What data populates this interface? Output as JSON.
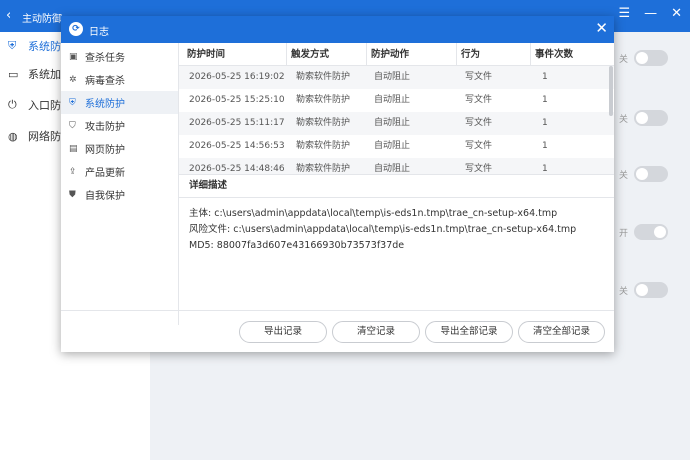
{
  "bg": {
    "title": "主动防御",
    "back_glyph": "‹",
    "win_buttons": [
      "☰",
      "—",
      "✕"
    ],
    "sidebar": [
      {
        "label": "系统防护",
        "icon": "shield-grid-icon",
        "glyph": "⛨"
      },
      {
        "label": "系统加固",
        "icon": "monitor-icon",
        "glyph": "▭"
      },
      {
        "label": "入口防护",
        "icon": "power-icon",
        "glyph": "⏻"
      },
      {
        "label": "网络防护",
        "icon": "globe-icon",
        "glyph": "◍"
      }
    ],
    "toggles": [
      {
        "state_label": "关",
        "on": false
      },
      {
        "state_label": "关",
        "on": false
      },
      {
        "state_label": "关",
        "on": false
      },
      {
        "state_label": "开",
        "on": true
      },
      {
        "state_label": "关",
        "on": false
      }
    ]
  },
  "dialog": {
    "title": "日志",
    "logo": "⟳",
    "close": "✕",
    "nav": [
      {
        "label": "查杀任务",
        "icon": "task-icon",
        "glyph": "▣",
        "active": false
      },
      {
        "label": "病毒查杀",
        "icon": "virus-icon",
        "glyph": "✲",
        "active": false
      },
      {
        "label": "系统防护",
        "icon": "system-protect-icon",
        "glyph": "⛨",
        "active": true
      },
      {
        "label": "攻击防护",
        "icon": "attack-shield-icon",
        "glyph": "⛉",
        "active": false
      },
      {
        "label": "网页防护",
        "icon": "web-page-icon",
        "glyph": "▤",
        "active": false
      },
      {
        "label": "产品更新",
        "icon": "update-icon",
        "glyph": "⇪",
        "active": false
      },
      {
        "label": "自我保护",
        "icon": "self-protect-icon",
        "glyph": "⛊",
        "active": false
      }
    ],
    "columns": [
      "防护时间",
      "触发方式",
      "防护动作",
      "行为",
      "事件次数"
    ],
    "rows": [
      [
        "2026-05-25 16:19:02",
        "勒索软件防护",
        "自动阻止",
        "写文件",
        "1"
      ],
      [
        "2026-05-25 15:25:10",
        "勒索软件防护",
        "自动阻止",
        "写文件",
        "1"
      ],
      [
        "2026-05-25 15:11:17",
        "勒索软件防护",
        "自动阻止",
        "写文件",
        "1"
      ],
      [
        "2026-05-25 14:56:53",
        "勒索软件防护",
        "自动阻止",
        "写文件",
        "1"
      ],
      [
        "2026-05-25 14:48:46",
        "勒索软件防护",
        "自动阻止",
        "写文件",
        "1"
      ]
    ],
    "detail_title": "详细描述",
    "detail_lines": [
      "主体: c:\\users\\admin\\appdata\\local\\temp\\is-eds1n.tmp\\trae_cn-setup-x64.tmp",
      "风险文件: c:\\users\\admin\\appdata\\local\\temp\\is-eds1n.tmp\\trae_cn-setup-x64.tmp",
      "MD5: 88007fa3d607e43166930b73573f37de"
    ],
    "buttons": [
      "导出记录",
      "清空记录",
      "导出全部记录",
      "清空全部记录"
    ]
  }
}
